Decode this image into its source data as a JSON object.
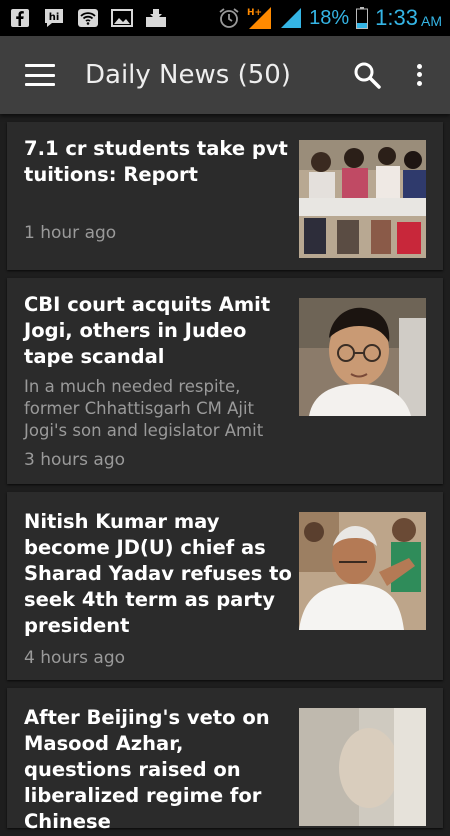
{
  "status_bar": {
    "icons": [
      "facebook-icon",
      "hike-icon",
      "wifi-icon",
      "gallery-icon",
      "download-icon",
      "alarm-icon",
      "network-hplus-icon",
      "signal-icon",
      "battery-icon"
    ],
    "network": "H+",
    "battery": "18%",
    "time": "1:33",
    "ampm": "AM",
    "color": "#35b5e5"
  },
  "app_bar": {
    "title": "Daily News (50)",
    "icons": [
      "menu-icon",
      "search-icon",
      "more-vert-icon"
    ]
  },
  "articles": [
    {
      "title": "7.1 cr students take pvt tuitions: Report",
      "summary": "",
      "time": "1 hour ago",
      "thumbnail": "students-writing-exam"
    },
    {
      "title": "CBI court acquits Amit Jogi, others in Judeo tape scandal",
      "summary": "In a much needed respite, former Chhattisgarh CM Ajit Jogi's son and legislator Amit",
      "time": "3 hours ago",
      "thumbnail": "man-with-glasses"
    },
    {
      "title": "Nitish Kumar may become JD(U) chief as Sharad Yadav refuses to seek 4th term as party president",
      "summary": "",
      "time": "4 hours ago",
      "thumbnail": "politician-speaking"
    },
    {
      "title": "After Beijing's veto on Masood Azhar, questions raised on liberalized regime for Chinese",
      "summary": "",
      "time": "",
      "thumbnail": "person-portrait"
    }
  ]
}
